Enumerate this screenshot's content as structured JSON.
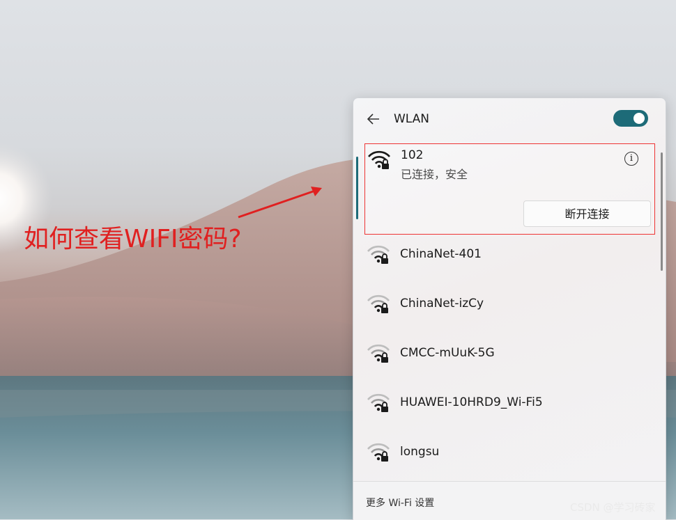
{
  "annotation": {
    "text": "如何查看WIFI密码?"
  },
  "panel": {
    "title": "WLAN",
    "toggle_on": true,
    "connected": {
      "name": "102",
      "status": "已连接，安全",
      "disconnect_label": "断开连接",
      "info_icon": "info-icon"
    },
    "networks": [
      {
        "name": "ChinaNet-401",
        "icon": "wifi-secured-icon"
      },
      {
        "name": "ChinaNet-izCy",
        "icon": "wifi-secured-icon"
      },
      {
        "name": "CMCC-mUuK-5G",
        "icon": "wifi-secured-icon"
      },
      {
        "name": "HUAWEI-10HRD9_Wi-Fi5",
        "icon": "wifi-secured-icon"
      },
      {
        "name": "longsu",
        "icon": "wifi-secured-icon"
      }
    ],
    "more_settings": "更多 Wi-Fi 设置"
  },
  "watermark": "CSDN @学习砖家",
  "colors": {
    "accent": "#1d6b78",
    "annotation": "#e02020"
  }
}
